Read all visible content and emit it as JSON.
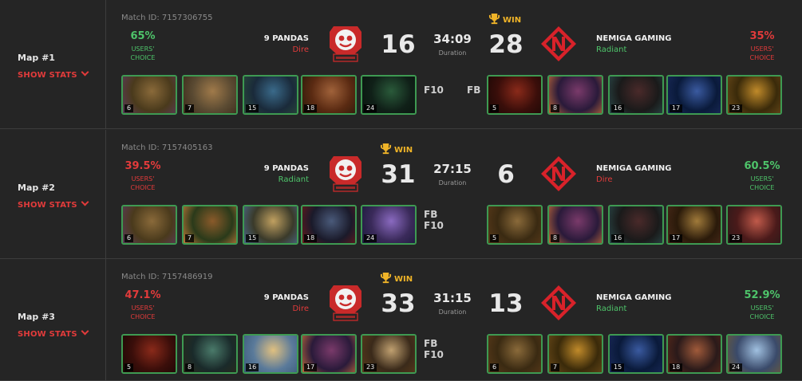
{
  "maps": [
    {
      "title": "Map #1",
      "show_stats": "SHOW STATS",
      "match_id": "Match ID: 7157306755",
      "duration": "34:09",
      "duration_label": "Duration",
      "winner": "right",
      "win_label": "WIN",
      "left": {
        "pct": "65%",
        "pct_color": "green",
        "choice": [
          "USERS'",
          "CHOICE"
        ],
        "team": "9 PANDAS",
        "side": "Dire",
        "side_color": "red",
        "score": "16",
        "tags": [
          "F10"
        ],
        "heroes": [
          {
            "level": "6",
            "colors": [
              "#4a3a1c",
              "#8a6a3a",
              "#5a3a5a"
            ]
          },
          {
            "level": "7",
            "colors": [
              "#5a4a32",
              "#a07a4a",
              "#3a2a1a"
            ]
          },
          {
            "level": "15",
            "colors": [
              "#1a2a3a",
              "#3a6a8a",
              "#2a4a3a"
            ]
          },
          {
            "level": "18",
            "colors": [
              "#5a2a12",
              "#a0623a",
              "#2a1a0a"
            ]
          },
          {
            "level": "24",
            "colors": [
              "#102018",
              "#2a5a3a",
              "#0a140e"
            ]
          }
        ]
      },
      "right": {
        "pct": "35%",
        "pct_color": "red",
        "choice": [
          "USERS'",
          "CHOICE"
        ],
        "team": "NEMIGA GAMING",
        "side": "Radiant",
        "side_color": "green",
        "score": "28",
        "tags": [
          "FB"
        ],
        "heroes": [
          {
            "level": "5",
            "colors": [
              "#3a0e0a",
              "#8a2a1a",
              "#1a0806"
            ]
          },
          {
            "level": "8",
            "colors": [
              "#2a1a3a",
              "#7a3a6a",
              "#c06a3a"
            ]
          },
          {
            "level": "16",
            "colors": [
              "#1a1a1a",
              "#4a2a2a",
              "#2a4a4a"
            ]
          },
          {
            "level": "17",
            "colors": [
              "#0a1a3a",
              "#3a5aa0",
              "#1a2a5a"
            ]
          },
          {
            "level": "23",
            "colors": [
              "#3a2a0a",
              "#c08a2a",
              "#6a4a1a"
            ]
          }
        ]
      }
    },
    {
      "title": "Map #2",
      "show_stats": "SHOW STATS",
      "match_id": "Match ID: 7157405163",
      "duration": "27:15",
      "duration_label": "Duration",
      "winner": "left",
      "win_label": "WIN",
      "left": {
        "pct": "39.5%",
        "pct_color": "red",
        "choice": [
          "USERS'",
          "CHOICE"
        ],
        "team": "9 PANDAS",
        "side": "Radiant",
        "side_color": "green",
        "score": "31",
        "tags": [
          "FB",
          "F10"
        ],
        "heroes": [
          {
            "level": "6",
            "colors": [
              "#4a3a1c",
              "#8a6a3a",
              "#5a3a5a"
            ]
          },
          {
            "level": "7",
            "colors": [
              "#2a3a1a",
              "#8a5a2a",
              "#c07a3a"
            ]
          },
          {
            "level": "15",
            "colors": [
              "#3a3a2a",
              "#c0a060",
              "#4a6a8a"
            ]
          },
          {
            "level": "18",
            "colors": [
              "#1a1a2a",
              "#4a5a7a",
              "#6a1a1a"
            ]
          },
          {
            "level": "24",
            "colors": [
              "#3a2a5a",
              "#8a6ac0",
              "#1a1a3a"
            ]
          }
        ]
      },
      "right": {
        "pct": "60.5%",
        "pct_color": "green",
        "choice": [
          "USERS'",
          "CHOICE"
        ],
        "team": "NEMIGA GAMING",
        "side": "Dire",
        "side_color": "red",
        "score": "6",
        "tags": [],
        "heroes": [
          {
            "level": "5",
            "colors": [
              "#3a2a12",
              "#8a6a3a",
              "#5a3a1a"
            ]
          },
          {
            "level": "8",
            "colors": [
              "#2a1a3a",
              "#7a3a6a",
              "#c06a3a"
            ]
          },
          {
            "level": "16",
            "colors": [
              "#1a1a1a",
              "#4a2a2a",
              "#2a4a4a"
            ]
          },
          {
            "level": "17",
            "colors": [
              "#2a1a0a",
              "#a07a3a",
              "#4a2a1a"
            ]
          },
          {
            "level": "23",
            "colors": [
              "#4a1a1a",
              "#c05a4a",
              "#2a1a1a"
            ]
          }
        ]
      }
    },
    {
      "title": "Map #3",
      "show_stats": "SHOW STATS",
      "match_id": "Match ID: 7157486919",
      "duration": "31:15",
      "duration_label": "Duration",
      "winner": "left",
      "win_label": "WIN",
      "left": {
        "pct": "47.1%",
        "pct_color": "red",
        "choice": [
          "USERS'",
          "CHOICE"
        ],
        "team": "9 PANDAS",
        "side": "Dire",
        "side_color": "red",
        "score": "33",
        "tags": [
          "FB",
          "F10"
        ],
        "heroes": [
          {
            "level": "5",
            "colors": [
              "#3a0e0a",
              "#8a2a1a",
              "#1a0806"
            ]
          },
          {
            "level": "8",
            "colors": [
              "#1a2a2a",
              "#4a7a6a",
              "#2a2a1a"
            ]
          },
          {
            "level": "16",
            "colors": [
              "#5a7a9a",
              "#e0c080",
              "#3a5a7a"
            ]
          },
          {
            "level": "17",
            "colors": [
              "#2a1a3a",
              "#7a3a6a",
              "#c06a3a"
            ]
          },
          {
            "level": "23",
            "colors": [
              "#3a2a1a",
              "#c0a070",
              "#5a3a1a"
            ]
          }
        ]
      },
      "right": {
        "pct": "52.9%",
        "pct_color": "green",
        "choice": [
          "USERS'",
          "CHOICE"
        ],
        "team": "NEMIGA GAMING",
        "side": "Radiant",
        "side_color": "green",
        "score": "13",
        "tags": [],
        "heroes": [
          {
            "level": "6",
            "colors": [
              "#3a2a12",
              "#8a6a3a",
              "#5a3a1a"
            ]
          },
          {
            "level": "7",
            "colors": [
              "#3a2a0a",
              "#c08a2a",
              "#6a4a1a"
            ]
          },
          {
            "level": "15",
            "colors": [
              "#0a1a3a",
              "#3a5aa0",
              "#1a2a5a"
            ]
          },
          {
            "level": "18",
            "colors": [
              "#2a1a1a",
              "#a05a3a",
              "#5a2a1a"
            ]
          },
          {
            "level": "24",
            "colors": [
              "#3a4a6a",
              "#a0c0e0",
              "#6a5a3a"
            ]
          }
        ]
      }
    }
  ]
}
